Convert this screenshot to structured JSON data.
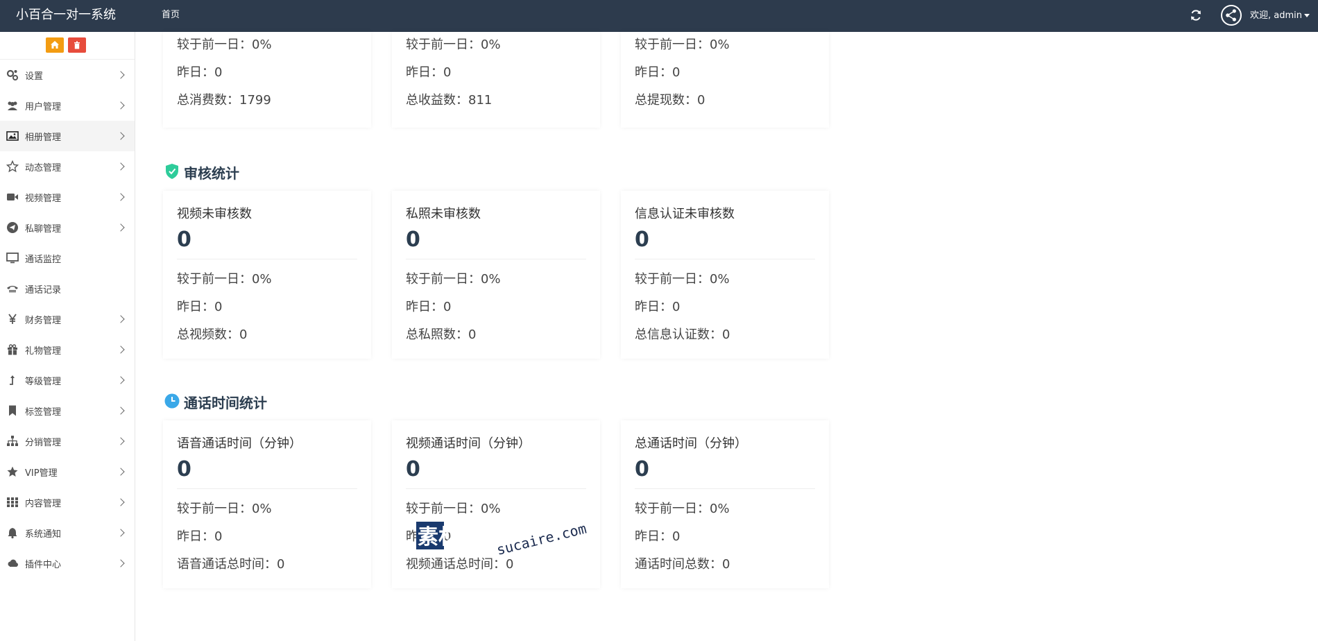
{
  "header": {
    "brand": "小百合一对一系统",
    "nav_home": "首页",
    "welcome": "欢迎, admin"
  },
  "sidebar": {
    "items": [
      {
        "label": "设置",
        "icon": "gears-icon",
        "arrow": true
      },
      {
        "label": "用户管理",
        "icon": "users-icon",
        "arrow": true
      },
      {
        "label": "相册管理",
        "icon": "image-icon",
        "arrow": true,
        "active": true
      },
      {
        "label": "动态管理",
        "icon": "star-outline-icon",
        "arrow": true
      },
      {
        "label": "视频管理",
        "icon": "video-camera-icon",
        "arrow": true
      },
      {
        "label": "私聊管理",
        "icon": "paper-plane-icon",
        "arrow": true
      },
      {
        "label": "通话监控",
        "icon": "monitor-icon",
        "arrow": false
      },
      {
        "label": "通话记录",
        "icon": "phone-icon",
        "arrow": false
      },
      {
        "label": "财务管理",
        "icon": "yen-icon",
        "arrow": true
      },
      {
        "label": "礼物管理",
        "icon": "gift-icon",
        "arrow": true
      },
      {
        "label": "等级管理",
        "icon": "level-up-icon",
        "arrow": true
      },
      {
        "label": "标签管理",
        "icon": "bookmark-icon",
        "arrow": true
      },
      {
        "label": "分销管理",
        "icon": "sitemap-icon",
        "arrow": true
      },
      {
        "label": "VIP管理",
        "icon": "star-icon",
        "arrow": true
      },
      {
        "label": "内容管理",
        "icon": "grid-icon",
        "arrow": true
      },
      {
        "label": "系统通知",
        "icon": "bell-icon",
        "arrow": true
      },
      {
        "label": "插件中心",
        "icon": "cloud-icon",
        "arrow": true
      }
    ]
  },
  "top_cards": [
    {
      "compare": "较于前一日：0%",
      "yesterday": "昨日：0",
      "total": "总消费数：1799"
    },
    {
      "compare": "较于前一日：0%",
      "yesterday": "昨日：0",
      "total": "总收益数：811"
    },
    {
      "compare": "较于前一日：0%",
      "yesterday": "昨日：0",
      "total": "总提现数：0"
    }
  ],
  "sections": [
    {
      "title": "审核统计",
      "icon": "shield-check-icon",
      "color": "#2ecc9a",
      "cards": [
        {
          "title": "视频未审核数",
          "value": "0",
          "compare": "较于前一日：0%",
          "yesterday": "昨日：0",
          "total": "总视频数：0"
        },
        {
          "title": "私照未审核数",
          "value": "0",
          "compare": "较于前一日：0%",
          "yesterday": "昨日：0",
          "total": "总私照数：0"
        },
        {
          "title": "信息认证未审核数",
          "value": "0",
          "compare": "较于前一日：0%",
          "yesterday": "昨日：0",
          "total": "总信息认证数：0"
        }
      ]
    },
    {
      "title": "通话时间统计",
      "icon": "clock-icon",
      "color": "#3aa8e8",
      "cards": [
        {
          "title": "语音通话时间（分钟）",
          "value": "0",
          "compare": "较于前一日：0%",
          "yesterday": "昨日：0",
          "total": "语音通话总时间：0"
        },
        {
          "title": "视频通话时间（分钟）",
          "value": "0",
          "compare": "较于前一日：0%",
          "yesterday": "昨日：0",
          "total": "视频通话总时间：0"
        },
        {
          "title": "总通话时间（分钟）",
          "value": "0",
          "compare": "较于前一日：0%",
          "yesterday": "昨日：0",
          "total": "通话时间总数：0"
        }
      ]
    }
  ],
  "watermark": {
    "text_cn": "素材熟",
    "text_en": "sucaire.com"
  },
  "colors": {
    "topbar": "#2d3b4d",
    "home_button": "#f39c12",
    "trash_button": "#e74c3c",
    "value_text": "#2c3e50"
  }
}
